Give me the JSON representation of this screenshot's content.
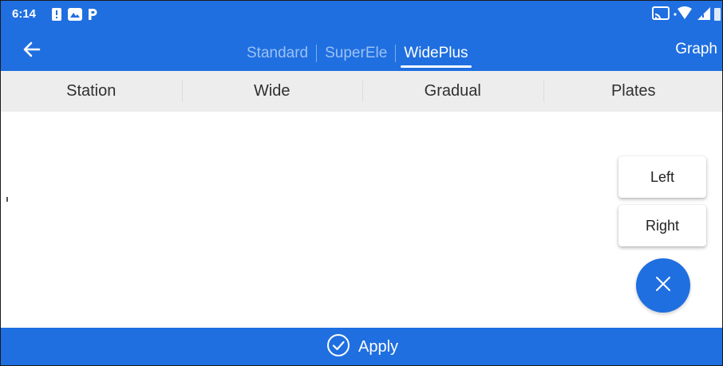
{
  "status_bar": {
    "time": "6:14",
    "left_icons": [
      "alert-icon",
      "photos-icon",
      "parking-icon"
    ],
    "right_icons": [
      "cast-icon",
      "wifi-icon",
      "signal-icon",
      "battery-icon"
    ]
  },
  "header": {
    "tabs": [
      {
        "label": "Standard",
        "active": false
      },
      {
        "label": "SuperEle",
        "active": false
      },
      {
        "label": "WidePlus",
        "active": true
      }
    ],
    "graph_label": "Graph"
  },
  "table": {
    "columns": [
      "Station",
      "Wide",
      "Gradual",
      "Plates"
    ],
    "rows": []
  },
  "side_actions": {
    "left_label": "Left",
    "right_label": "Right"
  },
  "footer": {
    "apply_label": "Apply"
  },
  "colors": {
    "primary": "#1f6fe0",
    "header_bg": "#ededed",
    "inactive_tab": "#9cc1f5"
  }
}
